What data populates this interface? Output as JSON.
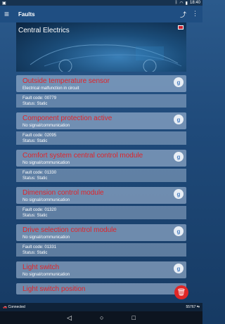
{
  "statusbar": {
    "time": "18:40"
  },
  "appbar": {
    "title": "Faults"
  },
  "hero": {
    "title": "Central Electrics"
  },
  "faults": [
    {
      "title": "Outside temperature sensor",
      "description": "Electrical malfunction in circuit",
      "fault_code": "Fault code: 00779",
      "status": "Status: Static"
    },
    {
      "title": "Component protection active",
      "description": "No signal/communication",
      "fault_code": "Fault code: 02095",
      "status": "Status: Static"
    },
    {
      "title": "Comfort system central control module",
      "description": "No signal/communication",
      "fault_code": "Fault code: 01330",
      "status": "Status: Static"
    },
    {
      "title": "Dimension control module",
      "description": "No signal/communication",
      "fault_code": "Fault code: 01320",
      "status": "Status: Static"
    },
    {
      "title": "Drive selection control module",
      "description": "No signal/communication",
      "fault_code": "Fault code: 01331",
      "status": "Status: Static"
    },
    {
      "title": "Light switch",
      "description": "No signal/communication",
      "fault_code": "",
      "status": ""
    },
    {
      "title": "Light switch position",
      "description": "",
      "fault_code": "",
      "status": ""
    }
  ],
  "connection": {
    "status": "Connected",
    "code": "55767"
  },
  "icons": {
    "menu": "menu-icon",
    "share": "share-icon",
    "more": "more-icon",
    "google": "google-icon",
    "delete": "trash-icon"
  }
}
